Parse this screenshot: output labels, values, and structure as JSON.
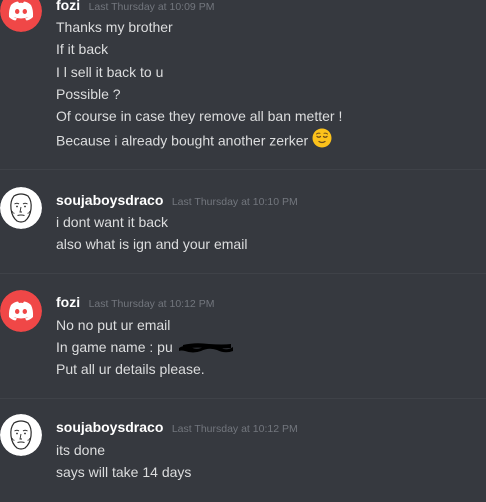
{
  "messages": [
    {
      "username": "fozi",
      "timestamp": "Last Thursday at 10:09 PM",
      "avatar_icon": "discord-logo-icon",
      "avatar_color": "#f04747",
      "lines": [
        "Thanks my brother",
        "If it back",
        "I l sell it back to u",
        "Possible ?",
        "Of course in case they remove all ban metter !",
        "Because i already bought another zerker"
      ],
      "emoji": "relieved-face-emoji"
    },
    {
      "username": "soujaboysdraco",
      "timestamp": "Last Thursday at 10:10 PM",
      "avatar_icon": "wojak-face-icon",
      "lines": [
        "i dont want it back",
        "also what is ign and your email"
      ]
    },
    {
      "username": "fozi",
      "timestamp": "Last Thursday at 10:12 PM",
      "avatar_icon": "discord-logo-icon",
      "avatar_color": "#f04747",
      "lines": [
        "No no put ur email",
        "In game name : pu",
        "Put all ur details please."
      ]
    },
    {
      "username": "soujaboysdraco",
      "timestamp": "Last Thursday at 10:12 PM",
      "avatar_icon": "wojak-face-icon",
      "lines": [
        "its done",
        "says will take 14 days"
      ]
    }
  ],
  "colors": {
    "background": "#36393f",
    "text": "#dcddde",
    "username": "#ffffff",
    "timestamp": "#72767d",
    "divider": "#3f4248"
  }
}
